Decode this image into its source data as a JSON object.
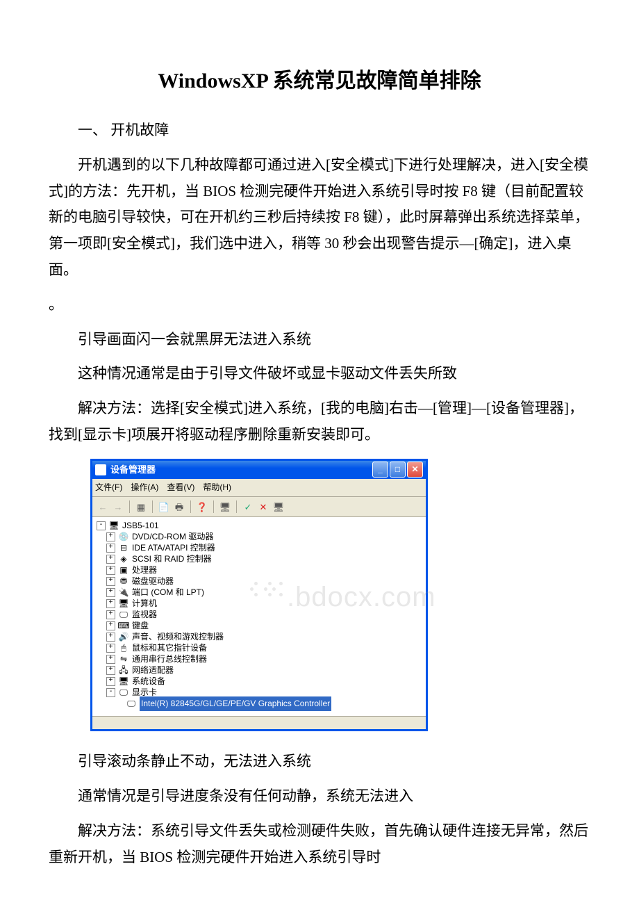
{
  "title": "WindowsXP 系统常见故障简单排除",
  "section1_heading": "一、 开机故障",
  "p1": "开机遇到的以下几种故障都可通过进入[安全模式]下进行处理解决，进入[安全模式]的方法：先开机，当 BIOS 检测完硬件开始进入系统引导时按 F8 键（目前配置较新的电脑引导较快，可在开机约三秒后持续按 F8 键），此时屏幕弹出系统选择菜单，第一项即[安全模式]，我们选中进入，稍等 30 秒会出现警告提示—[确定]，进入桌面。",
  "p2": "引导画面闪一会就黑屏无法进入系统",
  "p3": "这种情况通常是由于引导文件破坏或显卡驱动文件丢失所致",
  "p4": "解决方法：选择[安全模式]进入系统，[我的电脑]右击—[管理]—[设备管理器]，找到[显示卡]项展开将驱动程序删除重新安装即可。",
  "p5": "引导滚动条静止不动，无法进入系统",
  "p6": "通常情况是引导进度条没有任何动静，系统无法进入",
  "p7": "解决方法：系统引导文件丢失或检测硬件失败，首先确认硬件连接无异常，然后重新开机，当 BIOS 检测完硬件开始进入系统引导时",
  "devmgr": {
    "window_title": "设备管理器",
    "menu": {
      "file": "文件(F)",
      "action": "操作(A)",
      "view": "查看(V)",
      "help": "帮助(H)"
    },
    "root": "JSB5-101",
    "nodes": [
      {
        "label": "DVD/CD-ROM 驱动器",
        "icon": "💿"
      },
      {
        "label": "IDE ATA/ATAPI 控制器",
        "icon": "⊟"
      },
      {
        "label": "SCSI 和 RAID 控制器",
        "icon": "◈"
      },
      {
        "label": "处理器",
        "icon": "▣"
      },
      {
        "label": "磁盘驱动器",
        "icon": "⛃"
      },
      {
        "label": "端口 (COM 和 LPT)",
        "icon": "🔌"
      },
      {
        "label": "计算机",
        "icon": "🖥"
      },
      {
        "label": "监视器",
        "icon": "🖵"
      },
      {
        "label": "键盘",
        "icon": "⌨"
      },
      {
        "label": "声音、视频和游戏控制器",
        "icon": "🔊"
      },
      {
        "label": "鼠标和其它指针设备",
        "icon": "🖱"
      },
      {
        "label": "通用串行总线控制器",
        "icon": "⇋"
      },
      {
        "label": "网络适配器",
        "icon": "🖧"
      },
      {
        "label": "系统设备",
        "icon": "🖥"
      }
    ],
    "display_adapter_label": "显示卡",
    "display_adapter_icon": "🖵",
    "selected_driver": "Intel(R) 82845G/GL/GE/PE/GV Graphics Controller"
  },
  "watermark": ".bdocx.com"
}
